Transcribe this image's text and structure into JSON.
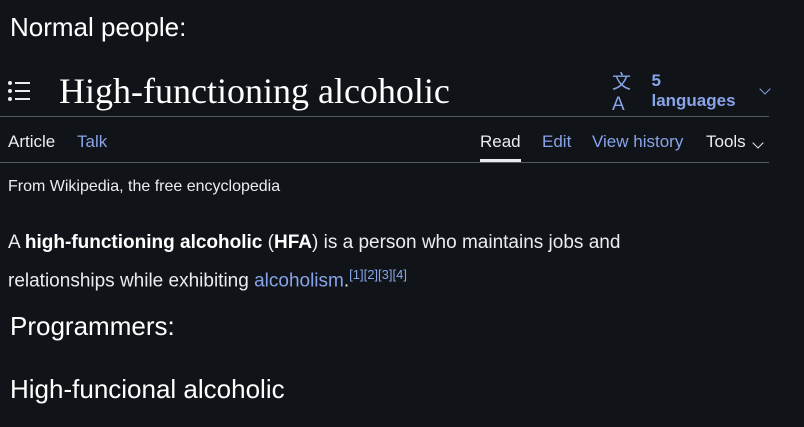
{
  "captions": {
    "top": "Normal people:",
    "middle": "Programmers:",
    "bottom": "High-funcional alcoholic"
  },
  "header": {
    "title": "High-functioning alcoholic",
    "languages": "5 languages"
  },
  "tabs": {
    "article": "Article",
    "talk": "Talk",
    "read": "Read",
    "edit": "Edit",
    "history": "View history",
    "tools": "Tools"
  },
  "content": {
    "from": "From Wikipedia, the free encyclopedia",
    "p_a": "A ",
    "p_bold1": "high-functioning alcoholic",
    "p_open": " (",
    "p_bold2": "HFA",
    "p_rest": ") is a person who maintains jobs and relationships while exhibiting ",
    "p_link": "alcoholism",
    "p_period": ".",
    "refs": "[1][2][3][4]"
  },
  "colors": {
    "background": "#101418",
    "link": "#88a3e8",
    "text": "#eaecf0"
  },
  "icons": {
    "toc": "list-icon",
    "language": "translate-icon",
    "dropdown": "chevron-down-icon"
  }
}
